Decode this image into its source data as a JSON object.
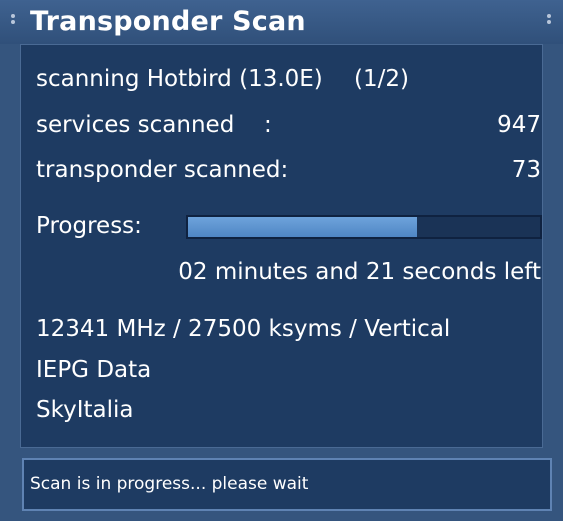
{
  "window": {
    "title": "Transponder Scan"
  },
  "scan": {
    "satellite_label": "scanning Hotbird (13.0E)",
    "satellite_count": "(1/2)",
    "services_label": "services scanned",
    "services_colon": ":",
    "services_value": "947",
    "transponder_label": "transponder scanned:",
    "transponder_value": "73",
    "progress_label": "Progress:",
    "progress_fraction": 0.65,
    "time_left": "02 minutes and 21 seconds left",
    "frequency_info": "12341 MHz / 27500 ksyms / Vertical",
    "provider_1": "IEPG Data",
    "provider_2": "SkyItalia"
  },
  "status": {
    "message": "Scan is in progress... please wait"
  },
  "colors": {
    "background": "#35557e",
    "panel": "#1e3b62",
    "progress_fill": "#5a90cc"
  }
}
